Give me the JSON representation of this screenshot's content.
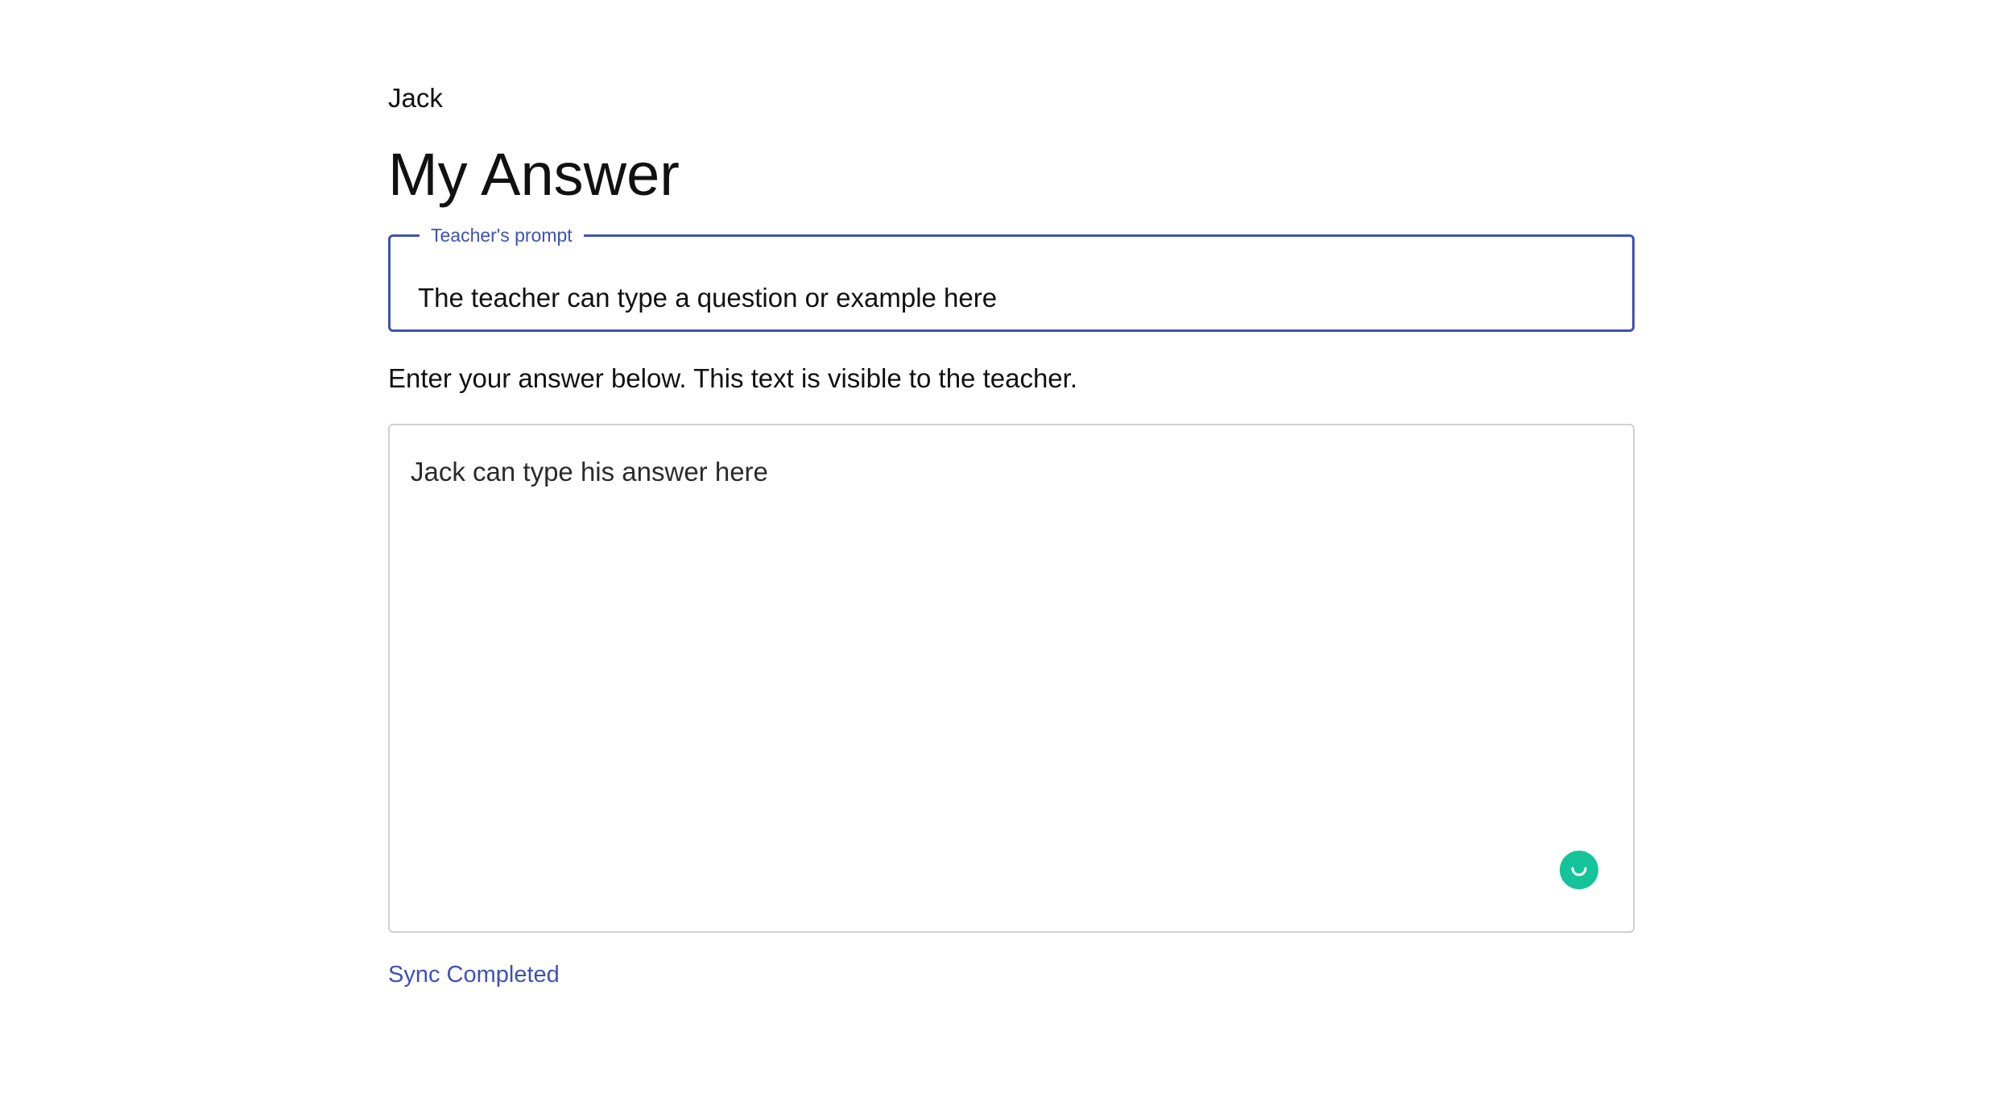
{
  "student": {
    "name": "Jack"
  },
  "page": {
    "title": "My Answer"
  },
  "prompt": {
    "legend": "Teacher's prompt",
    "text": "The teacher can type a question or example here"
  },
  "instructions": "Enter your answer below. This text is visible to the teacher.",
  "answer": {
    "text": "Jack can type his answer here"
  },
  "status": {
    "sync": "Sync Completed"
  },
  "colors": {
    "accent": "#3f51b5",
    "badge": "#15c39a",
    "border": "#cfcfcf"
  },
  "icons": {
    "badge": "grammar-assistant-icon"
  }
}
